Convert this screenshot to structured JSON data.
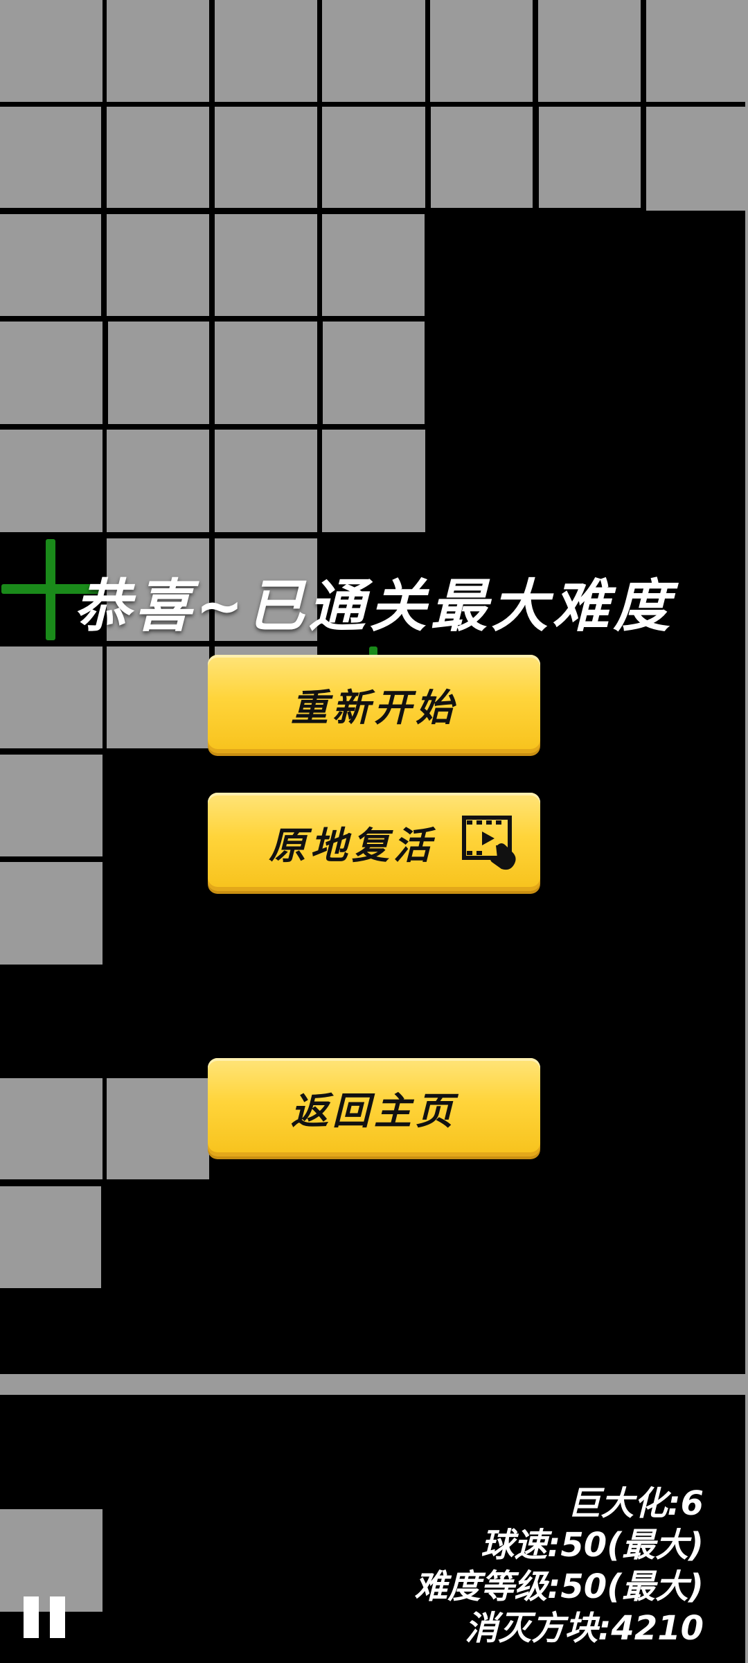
{
  "overlay": {
    "title": "恭喜~已通关最大难度",
    "buttons": {
      "restart_label": "重新开始",
      "revive_label": "原地复活",
      "home_label": "返回主页"
    },
    "revive_icon": "video-ad-icon"
  },
  "stats": {
    "giant": "巨大化:6",
    "ball_speed": "球速:50(最大)",
    "difficulty": "难度等级:50(最大)",
    "blocks_destroyed": "消灭方块:4210"
  },
  "controls": {
    "pause_icon": "pause-icon"
  },
  "colors": {
    "background": "#000000",
    "block": "#9b9b9b",
    "accent_green": "#1a8a1a",
    "button_yellow": "#ffd43a",
    "text": "#ffffff"
  }
}
